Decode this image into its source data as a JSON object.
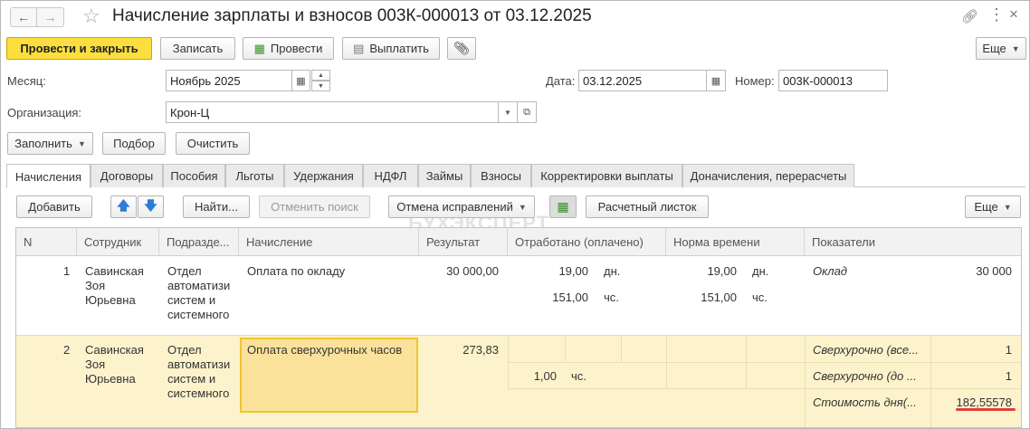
{
  "window": {
    "title": "Начисление зарплаты и взносов 003К-000013 от 03.12.2025"
  },
  "toolbar": {
    "post_close": "Провести и закрыть",
    "save": "Записать",
    "post": "Провести",
    "pay": "Выплатить",
    "more": "Еще"
  },
  "form": {
    "month_label": "Месяц:",
    "month_value": "Ноябрь 2025",
    "date_label": "Дата:",
    "date_value": "03.12.2025",
    "number_label": "Номер:",
    "number_value": "003К-000013",
    "org_label": "Организация:",
    "org_value": "Крон-Ц"
  },
  "actions": {
    "fill": "Заполнить",
    "pick": "Подбор",
    "clear": "Очистить"
  },
  "tabs": [
    "Начисления",
    "Договоры",
    "Пособия",
    "Льготы",
    "Удержания",
    "НДФЛ",
    "Займы",
    "Взносы",
    "Корректировки выплаты",
    "Доначисления, перерасчеты"
  ],
  "grid_toolbar": {
    "add": "Добавить",
    "find": "Найти...",
    "cancel_search": "Отменить поиск",
    "corrections": "Отмена исправлений",
    "payslip": "Расчетный листок",
    "more": "Еще"
  },
  "watermark": "БУХЭКСПЕРТ",
  "table": {
    "headers": [
      "N",
      "Сотрудник",
      "Подразде...",
      "Начисление",
      "Результат",
      "Отработано (оплачено)",
      "Норма времени",
      "Показатели"
    ],
    "rows": [
      {
        "n": "1",
        "employee": [
          "Савинская",
          "Зоя",
          "Юрьевна"
        ],
        "dept": [
          "Отдел",
          "автоматизи",
          "систем и",
          "системного"
        ],
        "accrual": "Оплата по окладу",
        "result": "30 000,00",
        "worked": [
          {
            "value": "19,00",
            "unit": "дн."
          },
          {
            "value": "151,00",
            "unit": "чс."
          }
        ],
        "norm": [
          {
            "value": "19,00",
            "unit": "дн."
          },
          {
            "value": "151,00",
            "unit": "чс."
          }
        ],
        "indicators": [
          {
            "name": "Оклад",
            "value": "30 000"
          }
        ]
      },
      {
        "n": "2",
        "employee": [
          "Савинская",
          "Зоя",
          "Юрьевна"
        ],
        "dept": [
          "Отдел",
          "автоматизи",
          "систем и",
          "системного"
        ],
        "accrual": "Оплата сверхурочных часов",
        "result": "273,83",
        "worked": [
          {
            "value": "1,00",
            "unit": "чс."
          }
        ],
        "norm": [],
        "indicators": [
          {
            "name": "Сверхурочно (все...",
            "value": "1"
          },
          {
            "name": "Сверхурочно (до ...",
            "value": "1"
          },
          {
            "name": "Стоимость дня(...",
            "value": "182,55578"
          }
        ]
      }
    ]
  }
}
